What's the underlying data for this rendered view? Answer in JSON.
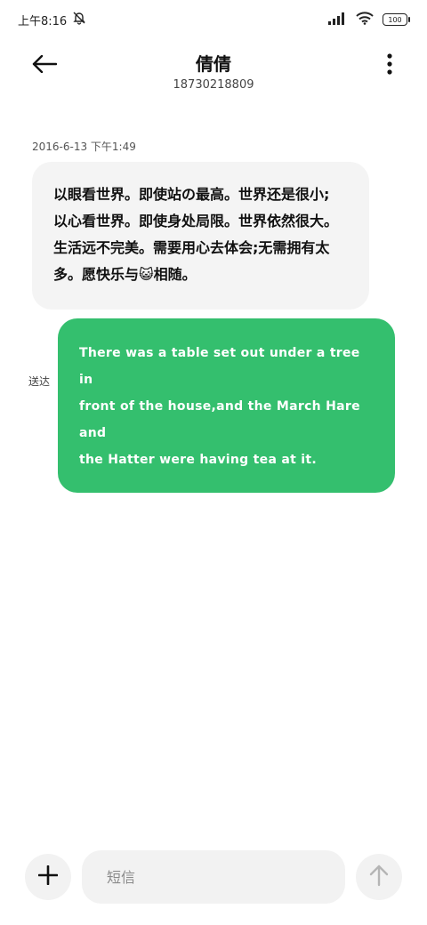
{
  "status_bar": {
    "time": "上午8:16",
    "battery": "100",
    "icons": [
      "bell-off-icon",
      "signal-icon",
      "wifi-icon",
      "battery-icon"
    ]
  },
  "header": {
    "contact_name": "倩倩",
    "contact_number": "18730218809",
    "icons": [
      "back-arrow-icon",
      "more-vertical-icon"
    ]
  },
  "conversation": {
    "timestamp": "2016-6-13 下午1:49",
    "messages": [
      {
        "direction": "incoming",
        "lines": [
          "以眼看世界。即使站の最高。世界还是很小;",
          "以心看世界。即使身处局限。世界依然很大。",
          "生活远不完美。需要用心去体会;无需拥有太",
          "多。愿快乐与😺相随。"
        ]
      },
      {
        "direction": "outgoing",
        "status": "送达",
        "lines": [
          "There was a table set out under a tree in",
          "front of the house,and the March Hare and",
          "the Hatter were having tea at it."
        ]
      }
    ]
  },
  "composer": {
    "placeholder": "短信",
    "icons": [
      "plus-icon",
      "send-arrow-icon"
    ]
  },
  "colors": {
    "outgoing_bubble": "#34bf6e",
    "incoming_bubble": "#f4f4f4",
    "button_bg": "#f2f2f2"
  }
}
